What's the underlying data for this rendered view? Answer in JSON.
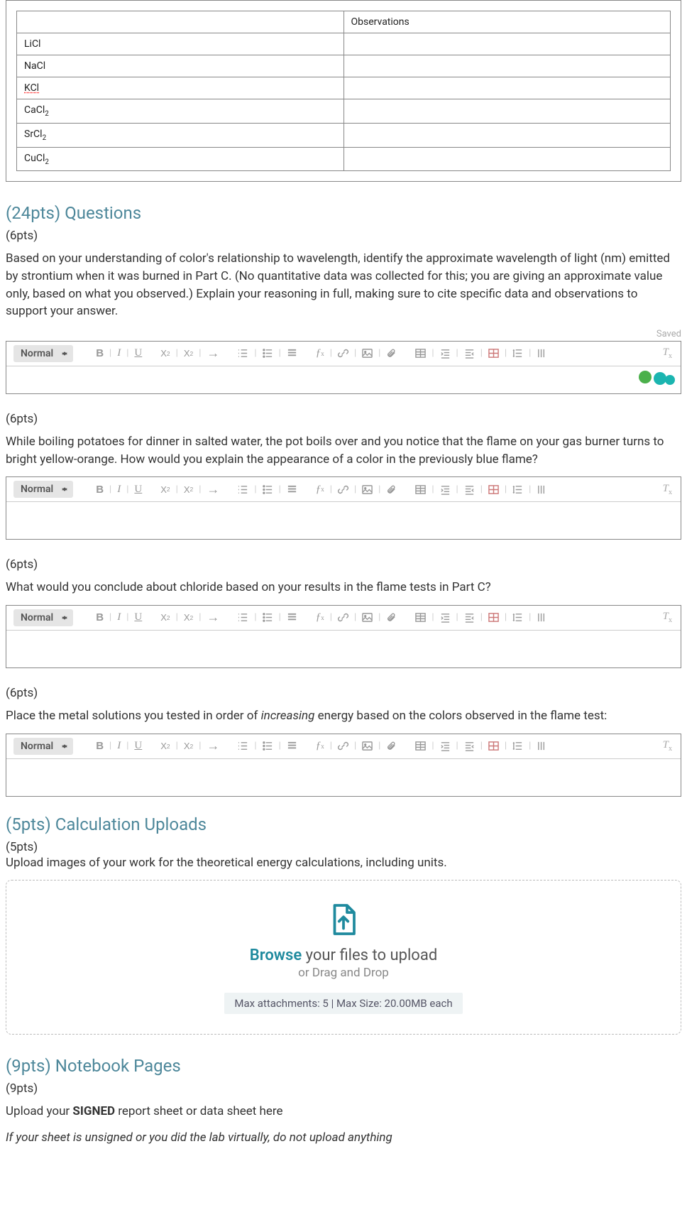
{
  "table": {
    "header_obs": "Observations",
    "rows": [
      {
        "name": "LiCl"
      },
      {
        "name": "NaCl"
      },
      {
        "name": "KCl",
        "dotted": true
      },
      {
        "name": "CaCl",
        "sub": "2"
      },
      {
        "name": "SrCl",
        "sub": "2"
      },
      {
        "name": "CuCl",
        "sub": "2"
      }
    ]
  },
  "sections": {
    "questions_title": "(24pts) Questions",
    "calc_title": "(5pts) Calculation Uploads",
    "notebook_title": "(9pts) Notebook Pages"
  },
  "q1": {
    "pts": "(6pts)",
    "text": "Based on your understanding of color's relationship to wavelength, identify the approximate wavelength of light (nm) emitted by strontium when it was burned in Part C. (No quantitative data was collected for this; you are giving an approximate value only, based on what you observed.) Explain your reasoning in full, making sure to cite specific data and observations to support your answer.",
    "saved": "Saved"
  },
  "q2": {
    "pts": "(6pts)",
    "text": "While boiling potatoes for dinner in salted water, the pot boils over and you notice that the flame on your gas burner turns to bright yellow-orange. How would you explain the appearance of a color in the previously blue flame?"
  },
  "q3": {
    "pts": "(6pts)",
    "text": "What would you conclude about chloride based on your results in the flame tests in Part C?"
  },
  "q4": {
    "pts": "(6pts)",
    "text_before": "Place the metal solutions you tested in order of ",
    "italic": "increasing",
    "text_after": " energy based on the colors observed in the flame test:"
  },
  "calc": {
    "pts": "(5pts)",
    "text": "Upload images of your work for the theoretical energy calculations, including units."
  },
  "upload": {
    "browse": "Browse",
    "rest": " your files to upload",
    "sub": "or Drag and Drop",
    "meta": "Max attachments: 5 | Max Size: 20.00MB each"
  },
  "notebook": {
    "pts": "(9pts)",
    "line1_a": "Upload your ",
    "line1_b": "SIGNED",
    "line1_c": " report sheet or data sheet here",
    "line2": "If your sheet is unsigned or you did the lab virtually, do not upload anything"
  },
  "toolbar": {
    "normal": "Normal",
    "b": "B",
    "i": "I",
    "u": "U",
    "sub": "X",
    "sup": "X",
    "fx": "ƒ"
  }
}
